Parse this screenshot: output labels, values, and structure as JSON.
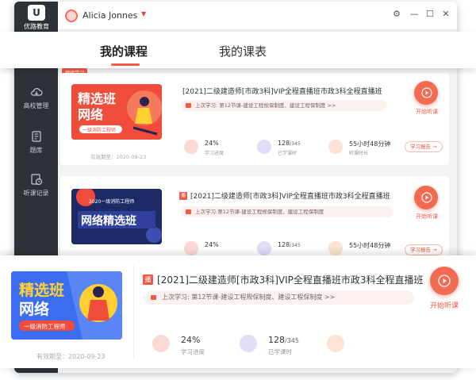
{
  "app": {
    "logo_text": "优路教育",
    "user_name": "Alicia Jonnes"
  },
  "tabs": [
    {
      "label": "我的课程"
    },
    {
      "label": "我的课表"
    }
  ],
  "sidebar": {
    "items": [
      {
        "label": "高校管理",
        "icon": "cloud-icon"
      },
      {
        "label": "题库",
        "icon": "book-icon"
      },
      {
        "label": "听课记录",
        "icon": "clock-record-icon"
      }
    ]
  },
  "continue_badge": "继续学习",
  "courses": [
    {
      "thumb_title": "精选班\n网络",
      "thumb_line1": "精选班",
      "thumb_line2": "网络",
      "thumb_sub": "一级消防工程师",
      "title": "[2021]二级建造师[市政3科]VIP全程直播班市政3科全程直播班",
      "last_prefix": "上次学习:",
      "last_text": "第12节课-建设工程规保制度、建设工程保制度 >>",
      "progress": "24%",
      "progress_label": "学习进度",
      "hours": "128",
      "hours_total": "/345",
      "hours_label": "已学课时",
      "duration": "55小时48分钟",
      "duration_label": "听课时长",
      "report": "学习报告",
      "play_label": "开始听课",
      "expiry": "有效期至：2020-09-23"
    },
    {
      "thumb_top": "2020一级消防工程师",
      "thumb_line1": "网络精选班",
      "title": "[2021]二级建造师[市政3科]VIP全程直播班市政3科全程直播班",
      "last_text": "上次学习:第12节课-建设工程规保制度、建设工程保制度",
      "progress": "24%",
      "hours": "128",
      "hours_total": "/345",
      "duration": "55小时48分钟",
      "report": "学习报告",
      "play_label": "开始听课"
    }
  ],
  "zoom": {
    "thumb_line1": "精选班",
    "thumb_line2": "网络",
    "thumb_sub": "一级消防工程师",
    "title": "[2021]二级建造师[市政3科]VIP全程直播班市政3科全程直播班",
    "last_prefix": "上次学习:",
    "last_text": "第12节课-建设工程规保制度、建设工程保制度 >>",
    "progress": "24%",
    "progress_label": "学习进度",
    "hours": "128",
    "hours_total": "/345",
    "hours_label": "已学课时",
    "play_label": "开始听课",
    "expiry": "有效期至：2020-09-23"
  },
  "colors": {
    "accent": "#f05a46",
    "sidebar": "#2d3138"
  }
}
